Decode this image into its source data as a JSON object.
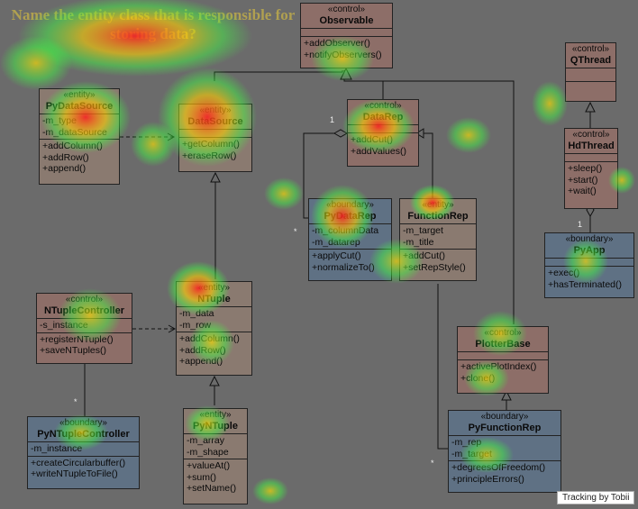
{
  "question": "Name the entity class that is responsible for storing data?",
  "watermark": "Tracking by Tobii",
  "multiplicity_one": "1",
  "multiplicity_many": "*",
  "classes": {
    "observable": {
      "stereo": "«control»",
      "name": "Observable",
      "attrs": [],
      "ops": [
        "+addObserver()",
        "+notifyObservers()"
      ]
    },
    "qthread": {
      "stereo": "«control»",
      "name": "QThread",
      "attrs": [],
      "ops": []
    },
    "pydatasource": {
      "stereo": "«entity»",
      "name": "PyDataSource",
      "attrs": [
        "-m_type",
        "-m_dataSource"
      ],
      "ops": [
        "+addColumn()",
        "+addRow()",
        "+append()"
      ]
    },
    "datasource": {
      "stereo": "«entity»",
      "name": "DataSource",
      "attrs": [],
      "ops": [
        "+getColumn()",
        "+eraseRow()"
      ]
    },
    "datarep": {
      "stereo": "«control»",
      "name": "DataRep",
      "attrs": [],
      "ops": [
        "+addCut()",
        "+addValues()"
      ]
    },
    "hdthread": {
      "stereo": "«control»",
      "name": "HdThread",
      "attrs": [],
      "ops": [
        "+sleep()",
        "+start()",
        "+wait()"
      ]
    },
    "pydatarep": {
      "stereo": "«boundary»",
      "name": "PyDataRep",
      "attrs": [
        "-m_columnData",
        "-m_datarep"
      ],
      "ops": [
        "+applyCut()",
        "+normalizeTo()"
      ]
    },
    "functionrep": {
      "stereo": "«entity»",
      "name": "FunctionRep",
      "attrs": [
        "-m_target",
        "-m_title"
      ],
      "ops": [
        "+addCut()",
        "+setRepStyle()"
      ]
    },
    "pyapp": {
      "stereo": "«boundary»",
      "name": "PyApp",
      "attrs": [],
      "ops": [
        "+exec()",
        "+hasTerminated()"
      ]
    },
    "ntuplecontroller": {
      "stereo": "«control»",
      "name": "NTupleController",
      "attrs": [
        "-s_instance"
      ],
      "ops": [
        "+registerNTuple()",
        "+saveNTuples()"
      ]
    },
    "ntuple": {
      "stereo": "«entity»",
      "name": "NTuple",
      "attrs": [
        "-m_data",
        "-m_row"
      ],
      "ops": [
        "+addColumn()",
        "+addRow()",
        "+append()"
      ]
    },
    "plotterbase": {
      "stereo": "«control»",
      "name": "PlotterBase",
      "attrs": [],
      "ops": [
        "+activePlotIndex()",
        "+clone()"
      ]
    },
    "pyntuplecontroller": {
      "stereo": "«boundary»",
      "name": "PyNTupleController",
      "attrs": [
        "-m_instance"
      ],
      "ops": [
        "+createCircularbuffer()",
        "+writeNTupleToFile()"
      ]
    },
    "pyntuple": {
      "stereo": "«entity»",
      "name": "PyNTuple",
      "attrs": [
        "-m_array",
        "-m_shape"
      ],
      "ops": [
        "+valueAt()",
        "+sum()",
        "+setName()"
      ]
    },
    "pyfunctionrep": {
      "stereo": "«boundary»",
      "name": "PyFunctionRep",
      "attrs": [
        "-m_rep",
        "-m_target"
      ],
      "ops": [
        "+degreesOfFreedom()",
        "+principleErrors()"
      ]
    }
  }
}
